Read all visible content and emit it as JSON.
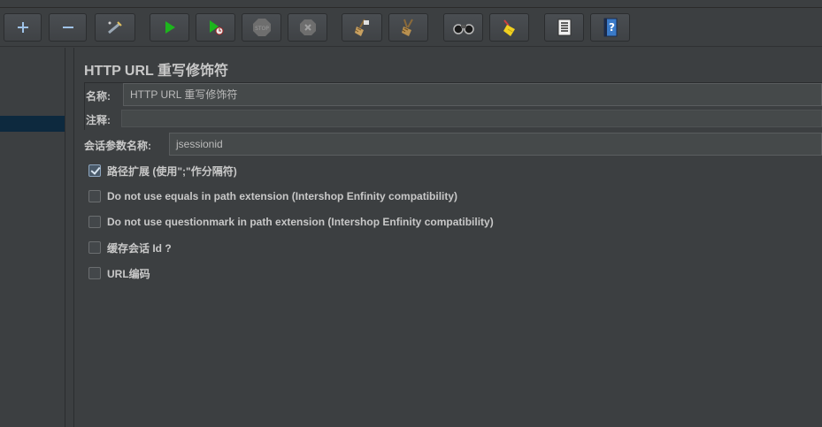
{
  "toolbar": {
    "buttons": [
      {
        "name": "add",
        "icon": "plus-icon"
      },
      {
        "name": "remove",
        "icon": "minus-icon"
      },
      {
        "name": "toggle",
        "icon": "wand-icon"
      },
      {
        "name": "start",
        "icon": "play-icon"
      },
      {
        "name": "start-no-pause",
        "icon": "play-timer-icon"
      },
      {
        "name": "stop",
        "icon": "stop-icon"
      },
      {
        "name": "shutdown",
        "icon": "shutdown-icon"
      },
      {
        "name": "clear",
        "icon": "broom-icon"
      },
      {
        "name": "clear-all",
        "icon": "broom-all-icon"
      },
      {
        "name": "search",
        "icon": "binoculars-icon"
      },
      {
        "name": "reset-search",
        "icon": "clear-search-icon"
      },
      {
        "name": "function-helper",
        "icon": "list-icon"
      },
      {
        "name": "help",
        "icon": "help-icon"
      }
    ],
    "colors": {
      "play": "#1db51d",
      "help": "#3a7ac8"
    }
  },
  "panel": {
    "title": "HTTP URL 重写修饰符",
    "name_label": "名称:",
    "name_value": "HTTP URL 重写修饰符",
    "comment_label": "注释:",
    "comment_value": "",
    "session_label": "会话参数名称:",
    "session_value": "jsessionid"
  },
  "options": [
    {
      "label": "路径扩展 (使用\";\"作分隔符)",
      "checked": true
    },
    {
      "label": "Do not use equals in path extension (Intershop Enfinity compatibility)",
      "checked": false
    },
    {
      "label": "Do not use questionmark in path extension (Intershop Enfinity compatibility)",
      "checked": false
    },
    {
      "label": "缓存会话 Id ?",
      "checked": false
    },
    {
      "label": "URL编码",
      "checked": false
    }
  ]
}
